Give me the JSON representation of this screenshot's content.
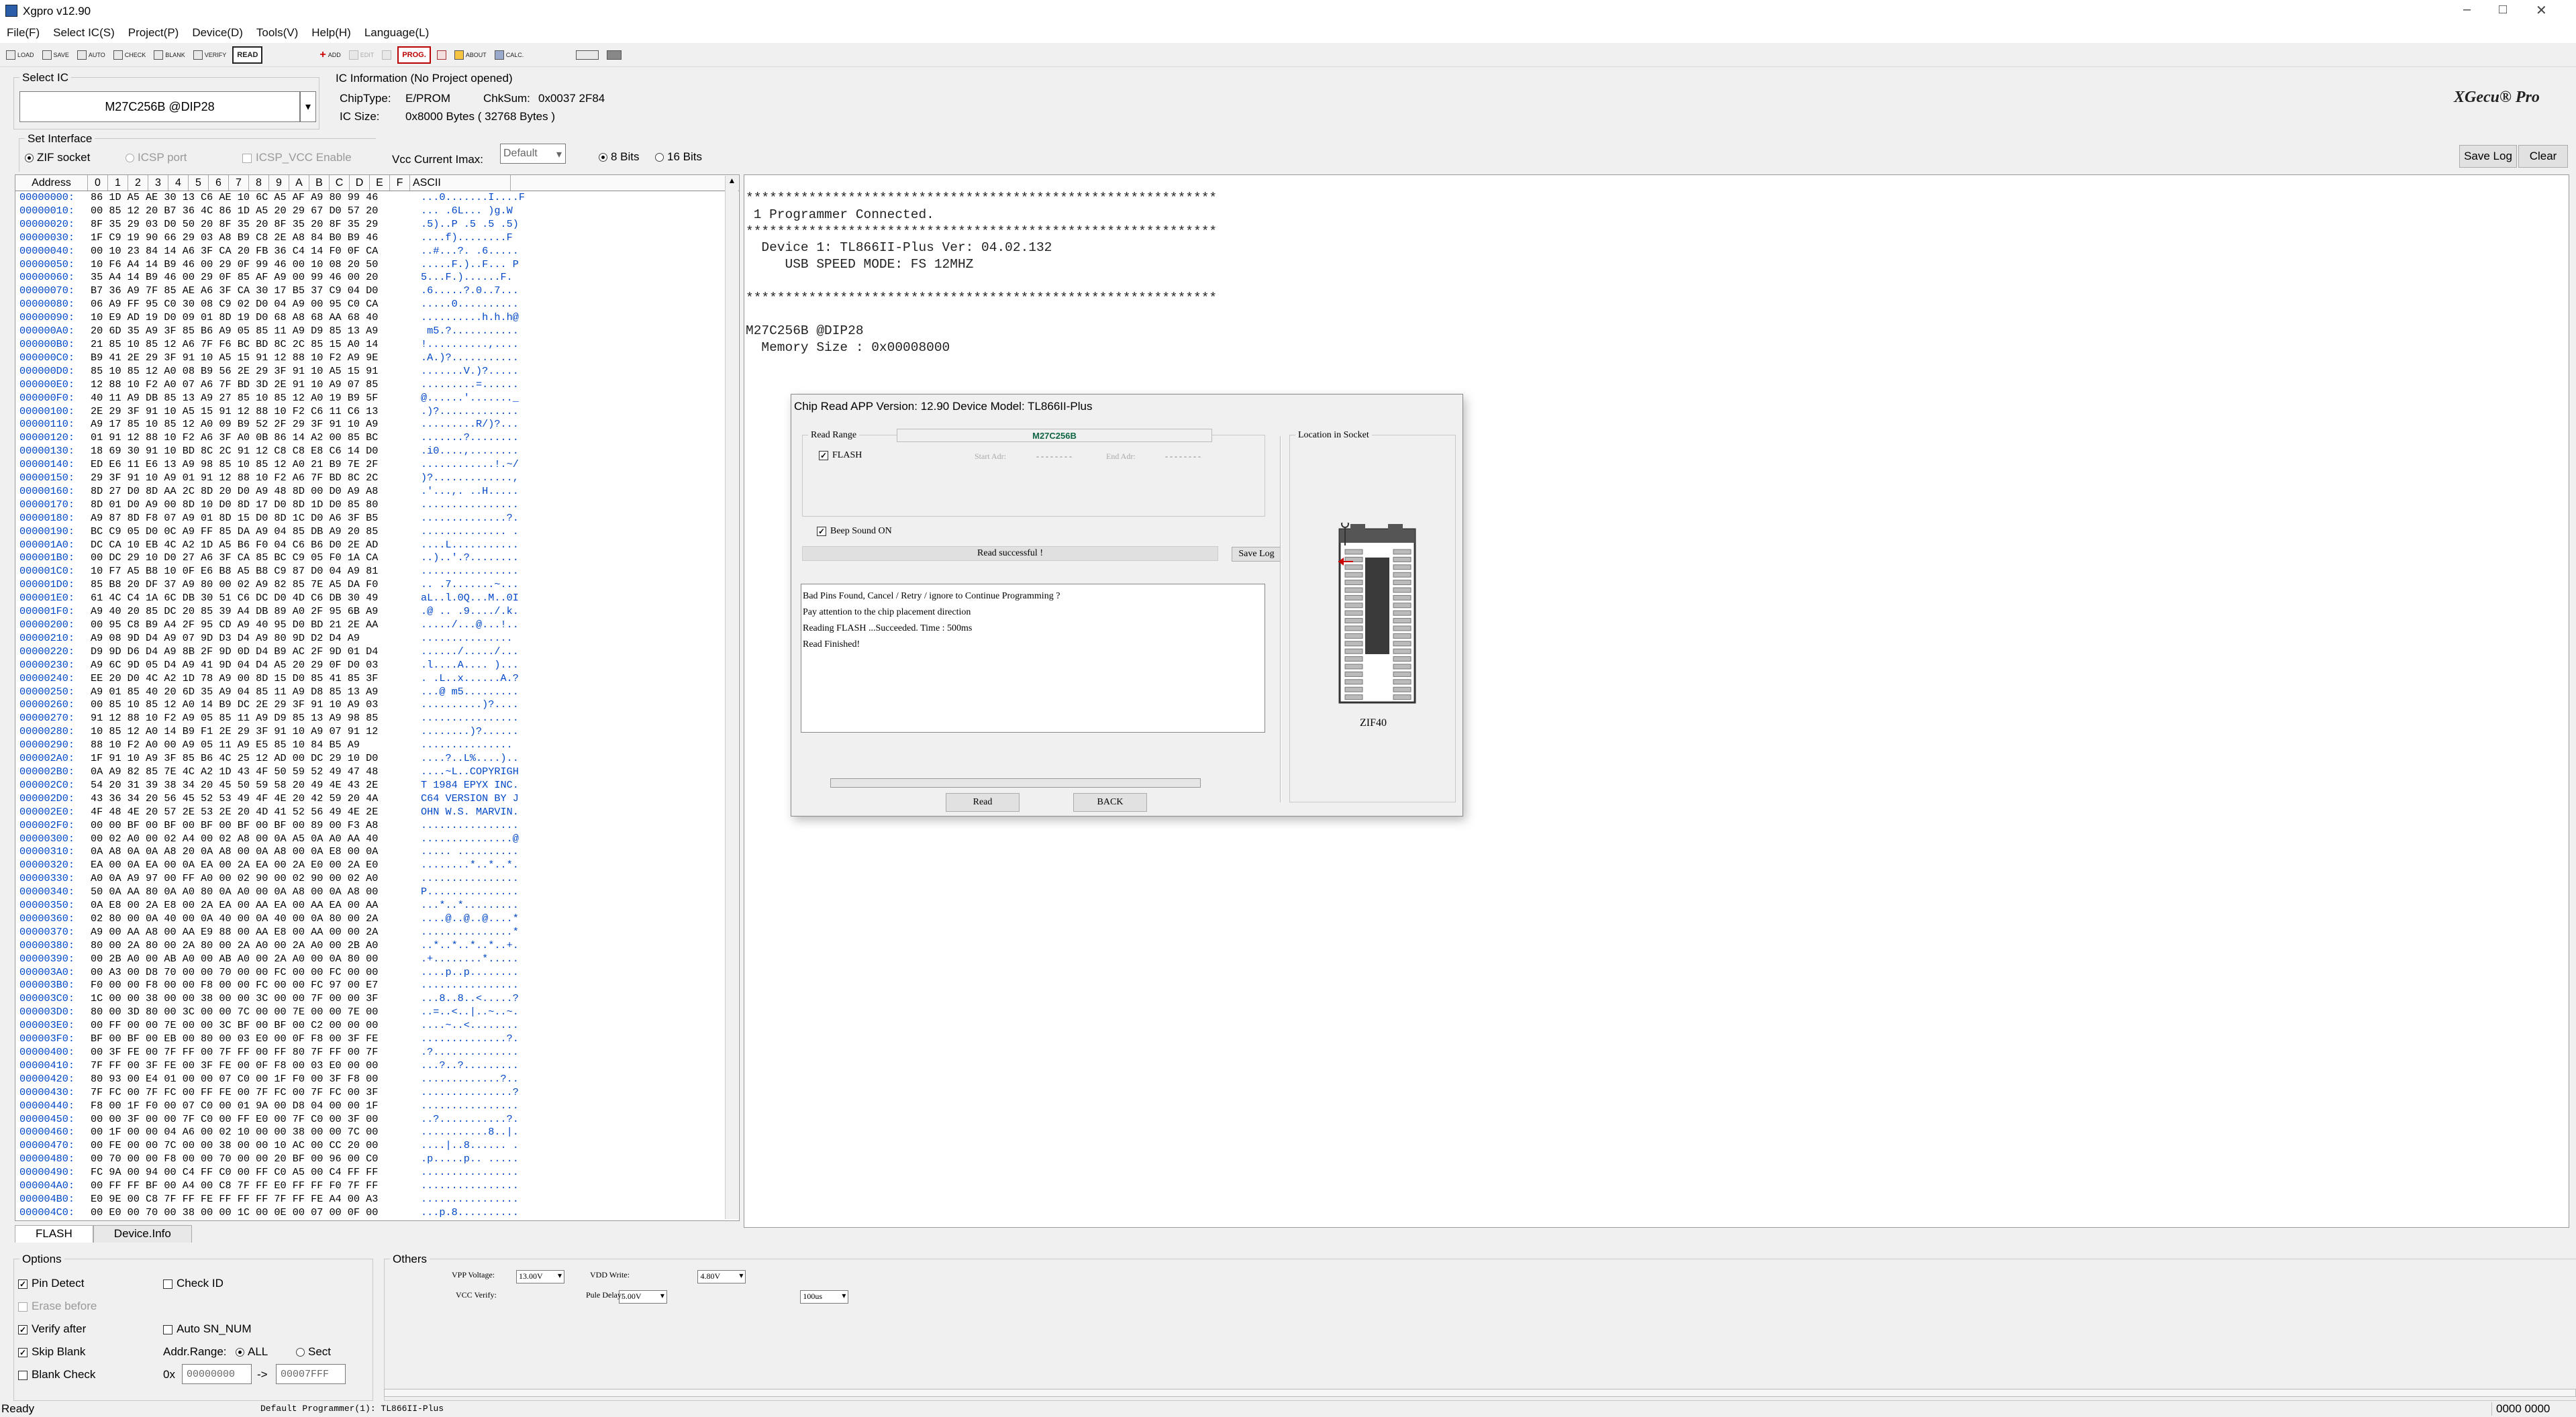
{
  "window": {
    "title": "Xgpro v12.90",
    "minimize": "–",
    "maximize": "□",
    "close": "✕"
  },
  "menu": [
    "File(F)",
    "Select IC(S)",
    "Project(P)",
    "Device(D)",
    "Tools(V)",
    "Help(H)",
    "Language(L)"
  ],
  "toolbar": {
    "load": "LOAD",
    "save": "SAVE",
    "auto": "AUTO",
    "check": "CHECK",
    "blank": "BLANK",
    "verify": "VERIFY",
    "read": "READ",
    "add": "ADD",
    "edit": "EDIT",
    "prog": "PROG.",
    "about": "ABOUT",
    "calc": "CALC."
  },
  "select_ic": {
    "label": "Select IC",
    "value": "M27C256B @DIP28",
    "dropdown": "▾"
  },
  "ic_info": {
    "label": "IC Information (No Project opened)",
    "chiptype_label": "ChipType:",
    "chiptype": "E/PROM",
    "chksum_label": "ChkSum:",
    "chksum": "0x0037 2F84",
    "icsize_label": "IC Size:",
    "icsize": "0x8000 Bytes ( 32768 Bytes )"
  },
  "brand": "XGecu® Pro",
  "interface": {
    "label": "Set Interface",
    "zif": "ZIF socket",
    "icsp": "ICSP port",
    "icsp_vcc": "ICSP_VCC Enable"
  },
  "vcc": {
    "label": "Vcc Current Imax:",
    "value": "Default"
  },
  "bits": {
    "eight": "8 Bits",
    "sixteen": "16 Bits"
  },
  "buttons": {
    "save_log": "Save Log",
    "clear": "Clear"
  },
  "hex": {
    "headers": [
      "Address",
      "0",
      "1",
      "2",
      "3",
      "4",
      "5",
      "6",
      "7",
      "8",
      "9",
      "A",
      "B",
      "C",
      "D",
      "E",
      "F",
      "ASCII"
    ],
    "rows": [
      [
        "00000000:",
        "86 1D A5 AE 30 13 C6 AE 10 6C A5 AF A9 80 99 46",
        "...0.......I....F"
      ],
      [
        "00000010:",
        "00 85 12 20 B7 36 4C 86 1D A5 20 29 67 D0 57 20",
        "... .6L... )g.W "
      ],
      [
        "00000020:",
        "8F 35 29 03 D0 50 20 8F 35 20 8F 35 20 8F 35 29",
        ".5)..P .5 .5 .5)"
      ],
      [
        "00000030:",
        "1F C9 19 90 66 29 03 A8 B9 C8 2E A8 84 B0 B9 46",
        "....f)........F"
      ],
      [
        "00000040:",
        "00 10 23 84 14 A6 3F CA 20 FB 36 C4 14 F0 0F CA",
        "..#...?. .6....."
      ],
      [
        "00000050:",
        "10 F6 A4 14 B9 46 00 29 0F 99 46 00 10 08 20 50",
        ".....F.)..F... P"
      ],
      [
        "00000060:",
        "35 A4 14 B9 46 00 29 0F 85 AF A9 00 99 46 00 20",
        "5...F.)......F. "
      ],
      [
        "00000070:",
        "B7 36 A9 7F 85 AE A6 3F CA 30 17 B5 37 C9 04 D0",
        ".6.....?.0..7..."
      ],
      [
        "00000080:",
        "06 A9 FF 95 C0 30 08 C9 02 D0 04 A9 00 95 C0 CA",
        ".....0.........."
      ],
      [
        "00000090:",
        "10 E9 AD 19 D0 09 01 8D 19 D0 68 A8 68 AA 68 40",
        "..........h.h.h@"
      ],
      [
        "000000A0:",
        "20 6D 35 A9 3F 85 B6 A9 05 85 11 A9 D9 85 13 A9",
        " m5.?..........."
      ],
      [
        "000000B0:",
        "21 85 10 85 12 A6 7F F6 BC BD 8C 2C 85 15 A0 14",
        "!..........,...."
      ],
      [
        "000000C0:",
        "B9 41 2E 29 3F 91 10 A5 15 91 12 88 10 F2 A9 9E",
        ".A.)?..........."
      ],
      [
        "000000D0:",
        "85 10 85 12 A0 08 B9 56 2E 29 3F 91 10 A5 15 91",
        ".......V.)?....."
      ],
      [
        "000000E0:",
        "12 88 10 F2 A0 07 A6 7F BD 3D 2E 91 10 A9 07 85",
        ".........=......"
      ],
      [
        "000000F0:",
        "40 11 A9 DB 85 13 A9 27 85 10 85 12 A0 19 B9 5F",
        "@......'......._"
      ],
      [
        "00000100:",
        "2E 29 3F 91 10 A5 15 91 12 88 10 F2 C6 11 C6 13",
        ".)?............."
      ],
      [
        "00000110:",
        "A9 17 85 10 85 12 A0 09 B9 52 2F 29 3F 91 10 A9",
        ".........R/)?..."
      ],
      [
        "00000120:",
        "01 91 12 88 10 F2 A6 3F A0 0B 86 14 A2 00 85 BC",
        ".......?........"
      ],
      [
        "00000130:",
        "18 69 30 91 10 BD 8C 2C 91 12 C8 C8 E8 C6 14 D0",
        ".i0....,........"
      ],
      [
        "00000140:",
        "ED E6 11 E6 13 A9 98 85 10 85 12 A0 21 B9 7E 2F",
        "............!.~/"
      ],
      [
        "00000150:",
        "29 3F 91 10 A9 01 91 12 88 10 F2 A6 7F BD 8C 2C",
        ")?.............,"
      ],
      [
        "00000160:",
        "8D 27 D0 8D AA 2C 8D 20 D0 A9 48 8D 00 D0 A9 A8",
        ".'...,. ..H....."
      ],
      [
        "00000170:",
        "8D 01 D0 A9 00 8D 10 D0 8D 17 D0 8D 1D D0 85 80",
        "................"
      ],
      [
        "00000180:",
        "A9 87 8D F8 07 A9 01 8D 15 D0 8D 1C D0 A6 3F B5",
        "..............?."
      ],
      [
        "00000190:",
        "BC C9 05 D0 0C A9 FF 85 DA A9 04 85 DB A9 20 85",
        ".............. ."
      ],
      [
        "000001A0:",
        "DC CA 10 EB 4C A2 1D A5 B6 F0 04 C6 B6 D0 2E AD",
        "....L..........."
      ],
      [
        "000001B0:",
        "00 DC 29 10 D0 27 A6 3F CA 85 BC C9 05 F0 1A CA",
        "..)..'.?........"
      ],
      [
        "000001C0:",
        "10 F7 A5 B8 10 0F E6 B8 A5 B8 C9 87 D0 04 A9 81",
        "................"
      ],
      [
        "000001D0:",
        "85 B8 20 DF 37 A9 80 00 02 A9 82 85 7E A5 DA F0",
        ".. .7.......~..."
      ],
      [
        "000001E0:",
        "61 4C C4 1A 6C DB 30 51 C6 DC D0 4D C6 DB 30 49",
        "aL..l.0Q...M..0I"
      ],
      [
        "000001F0:",
        "A9 40 20 85 DC 20 85 39 A4 DB 89 A0 2F 95 6B A9",
        ".@ .. .9..../.k."
      ],
      [
        "00000200:",
        "00 95 C8 B9 A4 2F 95 CD A9 40 95 D0 BD 21 2E AA",
        "...../...@...!.."
      ],
      [
        "00000210:",
        "A9 08 9D D4 A9 07 9D D3 D4 A9 80 9D D2 D4 A9",
        "..............."
      ],
      [
        "00000220:",
        "D9 9D D6 D4 A9 8B 2F 9D 0D D4 B9 AC 2F 9D 01 D4",
        "....../...../..."
      ],
      [
        "00000230:",
        "A9 6C 9D 05 D4 A9 41 9D 04 D4 A5 20 29 0F D0 03",
        ".l....A.... )..."
      ],
      [
        "00000240:",
        "EE 20 D0 4C A2 1D 78 A9 00 8D 15 D0 85 41 85 3F",
        ". .L..x......A.?"
      ],
      [
        "00000250:",
        "A9 01 85 40 20 6D 35 A9 04 85 11 A9 D8 85 13 A9",
        "...@ m5........."
      ],
      [
        "00000260:",
        "00 85 10 85 12 A0 14 B9 DC 2E 29 3F 91 10 A9 03",
        "..........)?...."
      ],
      [
        "00000270:",
        "91 12 88 10 F2 A9 05 85 11 A9 D9 85 13 A9 98 85",
        "................"
      ],
      [
        "00000280:",
        "10 85 12 A0 14 B9 F1 2E 29 3F 91 10 A9 07 91 12",
        "........)?......"
      ],
      [
        "00000290:",
        "88 10 F2 A0 00 A9 05 11 A9 E5 85 10 84 B5 A9",
        "..............."
      ],
      [
        "000002A0:",
        "1F 91 10 A9 3F 85 B6 4C 25 12 AD 00 DC 29 10 D0",
        "....?..L%....).."
      ],
      [
        "000002B0:",
        "0A A9 82 85 7E 4C A2 1D 43 4F 50 59 52 49 47 48",
        "....~L..COPYRIGH"
      ],
      [
        "000002C0:",
        "54 20 31 39 38 34 20 45 50 59 58 20 49 4E 43 2E",
        "T 1984 EPYX INC."
      ],
      [
        "000002D0:",
        "43 36 34 20 56 45 52 53 49 4F 4E 20 42 59 20 4A",
        "C64 VERSION BY J"
      ],
      [
        "000002E0:",
        "4F 48 4E 20 57 2E 53 2E 20 4D 41 52 56 49 4E 2E",
        "OHN W.S. MARVIN."
      ],
      [
        "000002F0:",
        "00 00 BF 00 BF 00 BF 00 BF 00 BF 00 89 00 F3 A8",
        "................"
      ],
      [
        "00000300:",
        "00 02 A0 00 02 A4 00 02 A8 00 0A A5 0A A0 AA 40",
        "...............@"
      ],
      [
        "00000310:",
        "0A A8 0A 0A A8 20 0A A8 00 0A A8 00 0A E8 00 0A",
        "..... .........."
      ],
      [
        "00000320:",
        "EA 00 0A EA 00 0A EA 00 2A EA 00 2A E0 00 2A E0",
        "........*..*..*."
      ],
      [
        "00000330:",
        "A0 0A A9 97 00 FF A0 00 02 90 00 02 90 00 02 A0",
        "................"
      ],
      [
        "00000340:",
        "50 0A AA 80 0A A0 80 0A A0 00 0A A8 00 0A A8 00",
        "P..............."
      ],
      [
        "00000350:",
        "0A E8 00 2A E8 00 2A EA 00 AA EA 00 AA EA 00 AA",
        "...*..*........."
      ],
      [
        "00000360:",
        "02 80 00 0A 40 00 0A 40 00 0A 40 00 0A 80 00 2A",
        "....@..@..@....*"
      ],
      [
        "00000370:",
        "A9 00 AA A8 00 AA E9 88 00 AA E8 00 AA 00 00 2A",
        "...............*"
      ],
      [
        "00000380:",
        "80 00 2A 80 00 2A 80 00 2A A0 00 2A A0 00 2B A0",
        "..*..*..*..*..+."
      ],
      [
        "00000390:",
        "00 2B A0 00 AB A0 00 AB A0 00 2A A0 00 0A 80 00",
        ".+........*....."
      ],
      [
        "000003A0:",
        "00 A3 00 D8 70 00 00 70 00 00 FC 00 00 FC 00 00",
        "....p..p........"
      ],
      [
        "000003B0:",
        "F0 00 00 F8 00 00 F8 00 00 FC 00 00 FC 97 00 E7",
        "................"
      ],
      [
        "000003C0:",
        "1C 00 00 38 00 00 38 00 00 3C 00 00 7F 00 00 3F",
        "...8..8..<.....?"
      ],
      [
        "000003D0:",
        "80 00 3D 80 00 3C 00 00 7C 00 00 7E 00 00 7E 00",
        "..=..<..|..~..~."
      ],
      [
        "000003E0:",
        "00 FF 00 00 7E 00 00 3C BF 00 BF 00 C2 00 00 00",
        "....~..<........"
      ],
      [
        "000003F0:",
        "BF 00 BF 00 EB 00 80 00 03 E0 00 0F F8 00 3F FE",
        "..............?."
      ],
      [
        "00000400:",
        "00 3F FE 00 7F FF 00 7F FF 00 FF 80 7F FF 00 7F",
        ".?.............."
      ],
      [
        "00000410:",
        "7F FF 00 3F FE 00 3F FE 00 0F F8 00 03 E0 00 00",
        "...?..?........."
      ],
      [
        "00000420:",
        "80 93 00 E4 01 00 00 07 C0 00 1F F0 00 3F F8 00",
        ".............?.."
      ],
      [
        "00000430:",
        "7F FC 00 7F FC 00 FF FE 00 7F FC 00 7F FC 00 3F",
        "...............?"
      ],
      [
        "00000440:",
        "F8 00 1F F0 00 07 C0 00 01 9A 00 D8 04 00 00 1F",
        "................"
      ],
      [
        "00000450:",
        "00 00 3F 00 00 7F C0 00 FF E0 00 7F C0 00 3F 00",
        "..?...........?."
      ],
      [
        "00000460:",
        "00 1F 00 00 04 A6 00 02 10 00 00 38 00 00 7C 00",
        "...........8..|."
      ],
      [
        "00000470:",
        "00 FE 00 00 7C 00 00 38 00 00 10 AC 00 CC 20 00",
        "....|..8...... ."
      ],
      [
        "00000480:",
        "00 70 00 00 F8 00 00 70 00 00 20 BF 00 96 00 C0",
        ".p.....p.. ....."
      ],
      [
        "00000490:",
        "FC 9A 00 94 00 C4 FF C0 00 FF C0 A5 00 C4 FF FF",
        "................"
      ],
      [
        "000004A0:",
        "00 FF FF BF 00 A4 00 C8 7F FF E0 FF FF F0 7F FF",
        "................"
      ],
      [
        "000004B0:",
        "E0 9E 00 C8 7F FF FE FF FF FF 7F FF FE A4 00 A3",
        "................"
      ],
      [
        "000004C0:",
        "00 E0 00 70 00 38 00 00 1C 00 0E 00 07 00 0F 00",
        "...p.8.........."
      ]
    ]
  },
  "log": {
    "lines": [
      "************************************************************",
      " 1 Programmer Connected.",
      "************************************************************",
      "  Device 1: TL866II-Plus Ver: 04.02.132",
      "     USB SPEED MODE: FS 12MHZ",
      "",
      "************************************************************",
      "",
      "M27C256B @DIP28",
      "  Memory Size : 0x00008000"
    ]
  },
  "dialog": {
    "title": "Chip Read    APP Version: 12.90 Device Model: TL866II-Plus",
    "chip_name": "M27C256B",
    "read_range_label": "Read Range",
    "flash": "FLASH",
    "start_adr_label": "Start Adr:",
    "start_adr": "- - - - - - - -",
    "end_adr_label": "End Adr:",
    "end_adr": "- - - - - - - -",
    "beep": "Beep Sound ON",
    "status": "Read successful !",
    "save_log": "Save Log",
    "messages": [
      "Bad Pins Found, Cancel / Retry / ignore to Continue Programming ?",
      "Pay attention to the chip placement direction",
      "Reading FLASH ...Succeeded. Time : 500ms",
      "Read Finished!"
    ],
    "read_btn": "Read",
    "back_btn": "BACK",
    "socket_label": "Location in Socket",
    "socket_name": "ZIF40"
  },
  "tabs": [
    "FLASH",
    "Device.Info"
  ],
  "options": {
    "label": "Options",
    "pin_detect": "Pin Detect",
    "check_id": "Check ID",
    "erase_before": "Erase before",
    "verify_after": "Verify after",
    "auto_sn": "Auto SN_NUM",
    "skip_blank": "Skip Blank",
    "addr_range": "Addr.Range:",
    "all": "ALL",
    "sect": "Sect",
    "blank_check": "Blank Check",
    "hex_prefix": "0x",
    "addr_from": "00000000",
    "arrow": "->",
    "addr_to": "00007FFF"
  },
  "others": {
    "label": "Others",
    "vpp_label": "VPP Voltage:",
    "vpp": "13.00V",
    "vdd_label": "VDD Write:",
    "vdd": "4.80V",
    "vcc_label": "VCC Verify:",
    "vcc": "5.00V",
    "pulse_label": "Pule Delay:",
    "pulse": "100us"
  },
  "status": {
    "left": "Ready",
    "programmer": "Default Programmer(1): TL866II-Plus",
    "right": "0000 0000"
  }
}
